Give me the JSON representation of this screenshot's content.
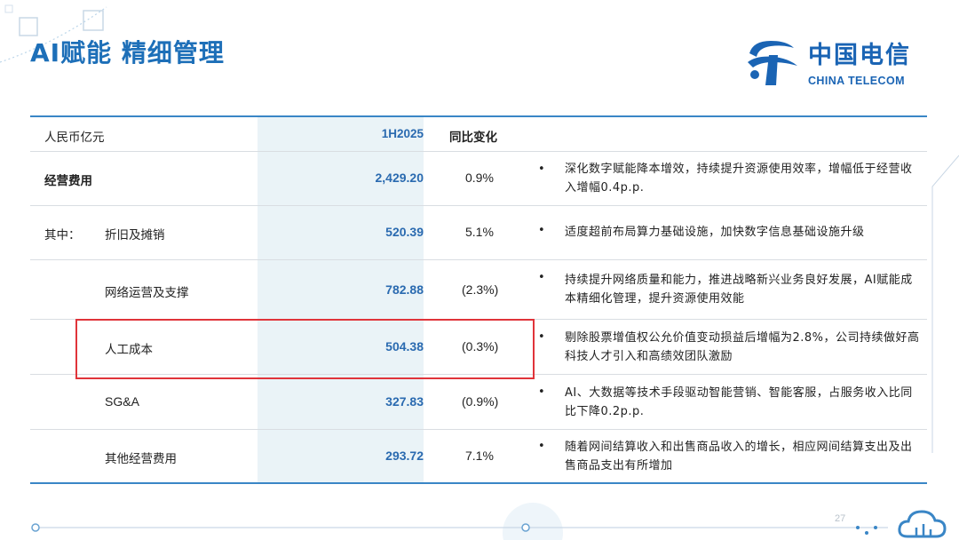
{
  "header": {
    "title": "AI赋能  精细管理",
    "logo_cn": "中国电信",
    "logo_en": "CHINA TELECOM"
  },
  "table": {
    "col_unit": "人民币亿元",
    "col_period": "1H2025",
    "col_change": "同比变化",
    "rows": [
      {
        "prefix": "",
        "label": "经营费用",
        "value": "2,429.20",
        "change": "0.9%",
        "comment": "深化数字赋能降本增效，持续提升资源使用效率，增幅低于经营收入增幅0.4p.p."
      },
      {
        "prefix": "其中：",
        "label": "折旧及摊销",
        "value": "520.39",
        "change": "5.1%",
        "comment": "适度超前布局算力基础设施，加快数字信息基础设施升级"
      },
      {
        "prefix": "",
        "label": "网络运营及支撑",
        "value": "782.88",
        "change": "(2.3%)",
        "comment": "持续提升网络质量和能力，推进战略新兴业务良好发展，AI赋能成本精细化管理，提升资源使用效能"
      },
      {
        "prefix": "",
        "label": "人工成本",
        "value": "504.38",
        "change": "(0.3%)",
        "comment": "剔除股票增值权公允价值变动损益后增幅为2.8%，公司持续做好高科技人才引入和高绩效团队激励"
      },
      {
        "prefix": "",
        "label": "SG&A",
        "value": "327.83",
        "change": "(0.9%)",
        "comment": "AI、大数据等技术手段驱动智能营销、智能客服，占服务收入比同比下降0.2p.p."
      },
      {
        "prefix": "",
        "label": "其他经营费用",
        "value": "293.72",
        "change": "7.1%",
        "comment": "随着网间结算收入和出售商品收入的增长，相应网间结算支出及出售商品支出有所增加"
      }
    ]
  },
  "footer": {
    "page_number": "27"
  },
  "colors": {
    "accent": "#1d6fb8",
    "highlight_box": "#e0343a",
    "column_tint": "#eaf3f7"
  }
}
